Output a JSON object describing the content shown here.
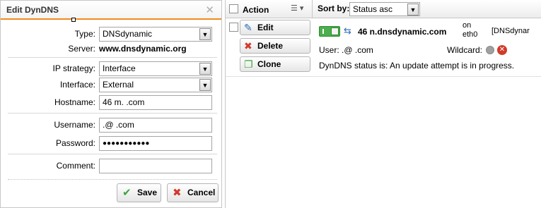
{
  "dialog": {
    "title": "Edit DynDNS",
    "close_icon": "close-icon",
    "type": {
      "label": "Type:",
      "value": "DNSdynamic"
    },
    "server": {
      "label": "Server:",
      "value": "www.dnsdynamic.org"
    },
    "ip_strategy": {
      "label": "IP strategy:",
      "value": "Interface"
    },
    "interface": {
      "label": "Interface:",
      "value": "External"
    },
    "hostname": {
      "label": "Hostname:",
      "value": "46      m.                    .com"
    },
    "username": {
      "label": "Username:",
      "value": "    .@                    .com"
    },
    "password": {
      "label": "Password:",
      "value": "●●●●●●●●●●●"
    },
    "comment": {
      "label": "Comment:",
      "value": ""
    },
    "save_label": "Save",
    "cancel_label": "Cancel"
  },
  "grid": {
    "header": {
      "action_label": "Action",
      "sort_by_label": "Sort by:",
      "sort_value": "Status asc"
    },
    "actions": {
      "edit_label": "Edit",
      "delete_label": "Delete",
      "clone_label": "Clone"
    },
    "entry": {
      "enabled": true,
      "hostname": "46       n.dnsdynamic.com",
      "on_label": "on",
      "interface": "eth0",
      "type": "[DNSdynar",
      "user_text": "User:    .@                    .com",
      "wildcard_label": "Wildcard:",
      "status_text": "DynDNS status is: An update attempt is in progress."
    }
  },
  "colors": {
    "accent": "#f08a1c",
    "toggle_on": "#4cae4c",
    "delete_red": "#d23a2a"
  }
}
